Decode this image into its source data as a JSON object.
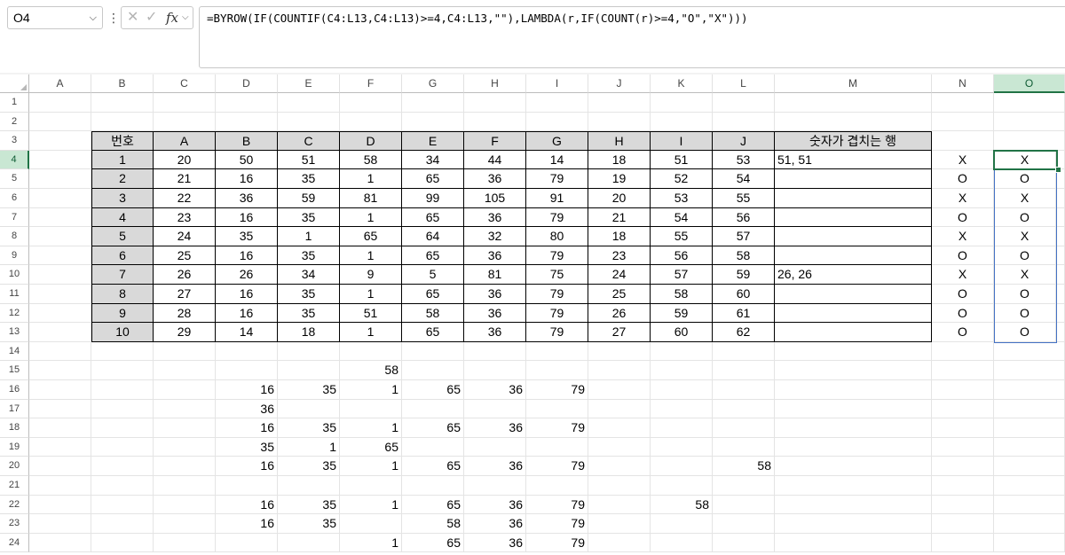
{
  "namebox": {
    "value": "O4"
  },
  "formula_bar": {
    "formula": "=BYROW(IF(COUNTIF(C4:L13,C4:L13)>=4,C4:L13,\"\"),LAMBDA(r,IF(COUNT(r)>=4,\"O\",\"X\")))"
  },
  "icons": {
    "cancel": "✕",
    "enter": "✓",
    "fx": "fx",
    "dropdown": "⌵",
    "grip": "⋮"
  },
  "colors": {
    "accent": "#217346",
    "header_fill": "#d9d9d9",
    "selection": "#4472c4"
  },
  "columns": [
    "A",
    "B",
    "C",
    "D",
    "E",
    "F",
    "G",
    "H",
    "I",
    "J",
    "K",
    "L",
    "M",
    "N",
    "O"
  ],
  "selected_column": "O",
  "rows": [
    "1",
    "2",
    "3",
    "4",
    "5",
    "6",
    "7",
    "8",
    "9",
    "10",
    "11",
    "12",
    "13",
    "14",
    "15",
    "16",
    "17",
    "18",
    "19",
    "20",
    "21",
    "22",
    "23",
    "24"
  ],
  "selected_row": "4",
  "table": {
    "headers": [
      "번호",
      "A",
      "B",
      "C",
      "D",
      "E",
      "F",
      "G",
      "H",
      "I",
      "J",
      "숫자가 겹치는 행"
    ],
    "rows": [
      [
        "1",
        "20",
        "50",
        "51",
        "58",
        "34",
        "44",
        "14",
        "18",
        "51",
        "53",
        "51, 51"
      ],
      [
        "2",
        "21",
        "16",
        "35",
        "1",
        "65",
        "36",
        "79",
        "19",
        "52",
        "54",
        ""
      ],
      [
        "3",
        "22",
        "36",
        "59",
        "81",
        "99",
        "105",
        "91",
        "20",
        "53",
        "55",
        ""
      ],
      [
        "4",
        "23",
        "16",
        "35",
        "1",
        "65",
        "36",
        "79",
        "21",
        "54",
        "56",
        ""
      ],
      [
        "5",
        "24",
        "35",
        "1",
        "65",
        "64",
        "32",
        "80",
        "18",
        "55",
        "57",
        ""
      ],
      [
        "6",
        "25",
        "16",
        "35",
        "1",
        "65",
        "36",
        "79",
        "23",
        "56",
        "58",
        ""
      ],
      [
        "7",
        "26",
        "26",
        "34",
        "9",
        "5",
        "81",
        "75",
        "24",
        "57",
        "59",
        "26, 26"
      ],
      [
        "8",
        "27",
        "16",
        "35",
        "1",
        "65",
        "36",
        "79",
        "25",
        "58",
        "60",
        ""
      ],
      [
        "9",
        "28",
        "16",
        "35",
        "51",
        "58",
        "36",
        "79",
        "26",
        "59",
        "61",
        ""
      ],
      [
        "10",
        "29",
        "14",
        "18",
        "1",
        "65",
        "36",
        "79",
        "27",
        "60",
        "62",
        ""
      ]
    ]
  },
  "col_n": [
    "X",
    "O",
    "X",
    "O",
    "X",
    "O",
    "X",
    "O",
    "O",
    "O"
  ],
  "col_o": [
    "X",
    "O",
    "X",
    "O",
    "X",
    "O",
    "X",
    "O",
    "O",
    "O"
  ],
  "lower": {
    "r15": [
      "",
      "",
      "",
      "58",
      "",
      "",
      "",
      "",
      "",
      ""
    ],
    "r16": [
      "",
      "16",
      "35",
      "1",
      "65",
      "36",
      "79",
      "",
      "",
      ""
    ],
    "r17": [
      "",
      "36",
      "",
      "",
      "",
      "",
      "",
      "",
      "",
      ""
    ],
    "r18": [
      "",
      "16",
      "35",
      "1",
      "65",
      "36",
      "79",
      "",
      "",
      ""
    ],
    "r19": [
      "",
      "35",
      "1",
      "65",
      "",
      "",
      "",
      "",
      "",
      ""
    ],
    "r20": [
      "",
      "16",
      "35",
      "1",
      "65",
      "36",
      "79",
      "",
      "",
      "58"
    ],
    "r21": [
      "",
      "",
      "",
      "",
      "",
      "",
      "",
      "",
      "",
      ""
    ],
    "r22": [
      "",
      "16",
      "35",
      "1",
      "65",
      "36",
      "79",
      "",
      "58",
      ""
    ],
    "r23": [
      "",
      "16",
      "35",
      "",
      "58",
      "36",
      "79",
      "",
      "",
      ""
    ],
    "r24": [
      "",
      "",
      "",
      "1",
      "65",
      "36",
      "79",
      "",
      "",
      ""
    ]
  }
}
